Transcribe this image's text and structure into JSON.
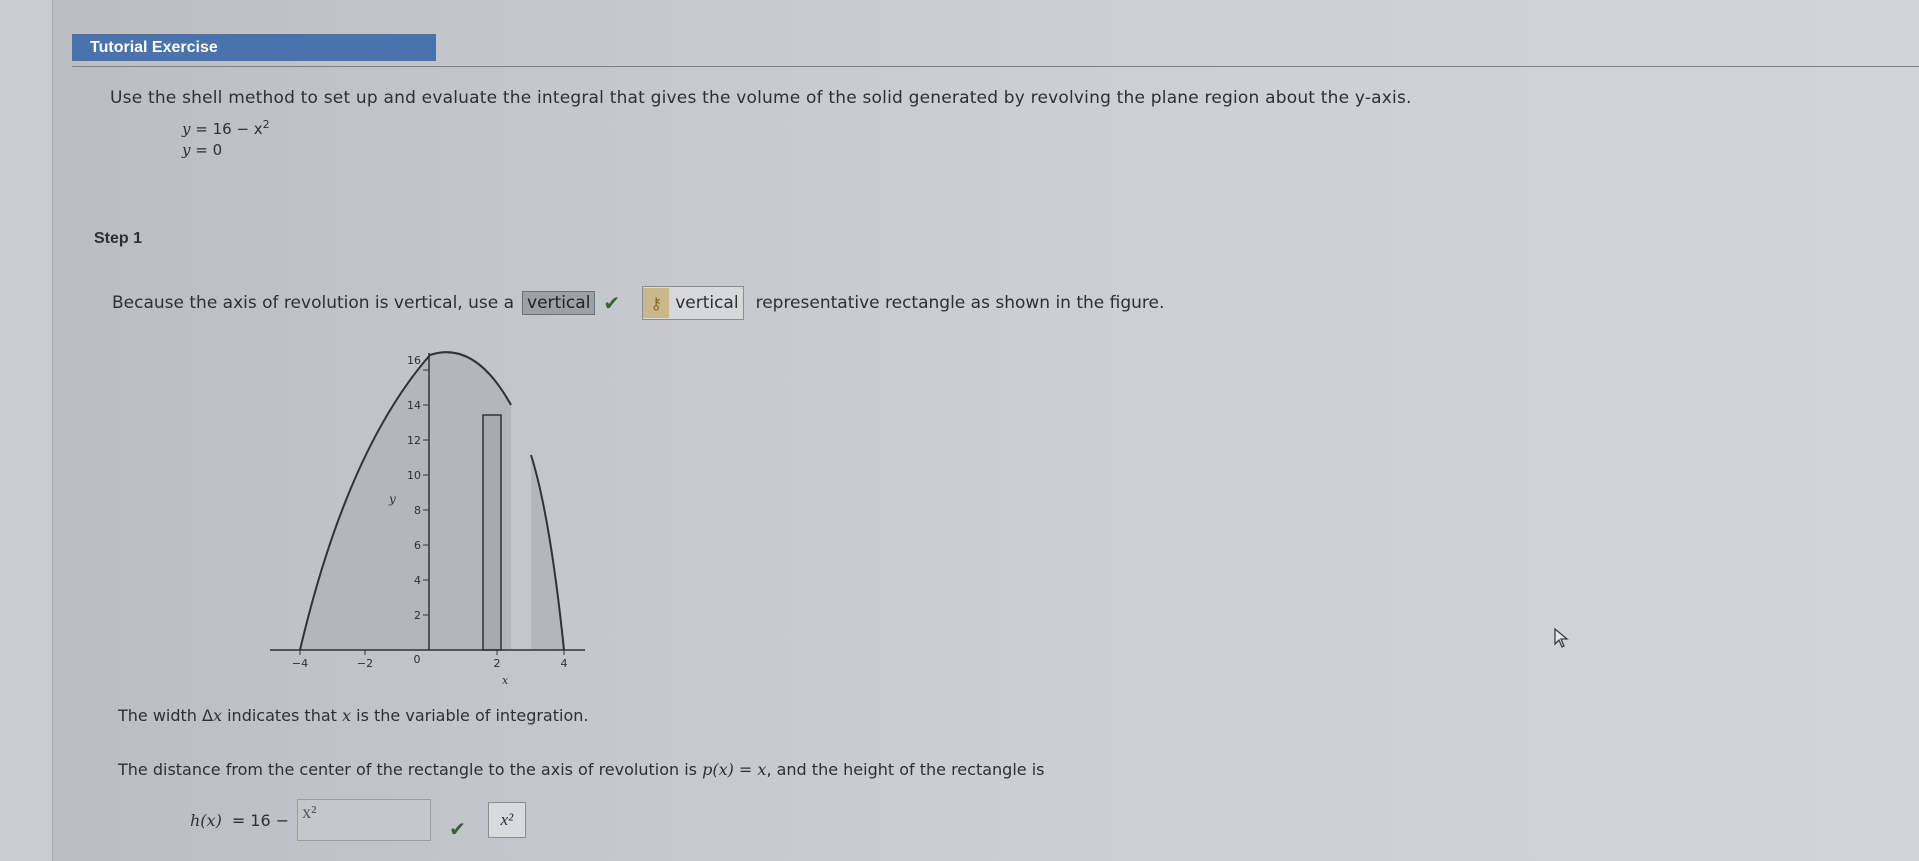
{
  "header": {
    "title": "Tutorial Exercise"
  },
  "problem": {
    "statement": "Use the shell method to set up and evaluate the integral that gives the volume of the solid generated by revolving the plane region about the y-axis.",
    "eq1_lhs": "y",
    "eq1_rhs": "= 16 − x",
    "eq1_exp": "2",
    "eq2_lhs": "y",
    "eq2_rhs": "= 0"
  },
  "step": {
    "label": "Step 1",
    "sentence_start": "Because the axis of revolution is vertical, use a",
    "answer_value": "vertical",
    "key_value": "vertical",
    "sentence_end": "representative rectangle as shown in the figure."
  },
  "figure": {
    "y_ticks": [
      "2",
      "4",
      "6",
      "8",
      "10",
      "12",
      "14",
      "16"
    ],
    "x_ticks": [
      "−4",
      "−2",
      "0",
      "2",
      "4"
    ],
    "y_label": "y",
    "x_label": "x"
  },
  "notes": {
    "width_start": "The width Δ",
    "width_var": "x",
    "width_mid": " indicates that ",
    "width_var2": "x",
    "width_end": " is the variable of integration.",
    "distance_start": "The distance from the center of the rectangle to the axis of revolution is ",
    "distance_expr": "p(x) = x",
    "distance_end": ", and the height of the rectangle is"
  },
  "height": {
    "lhs": "h(x)",
    "mid": "= 16 −",
    "input_value": "x²",
    "key_value": "x²"
  },
  "colors": {
    "header_bg": "#4a73ae",
    "check": "#3a5f3a"
  }
}
